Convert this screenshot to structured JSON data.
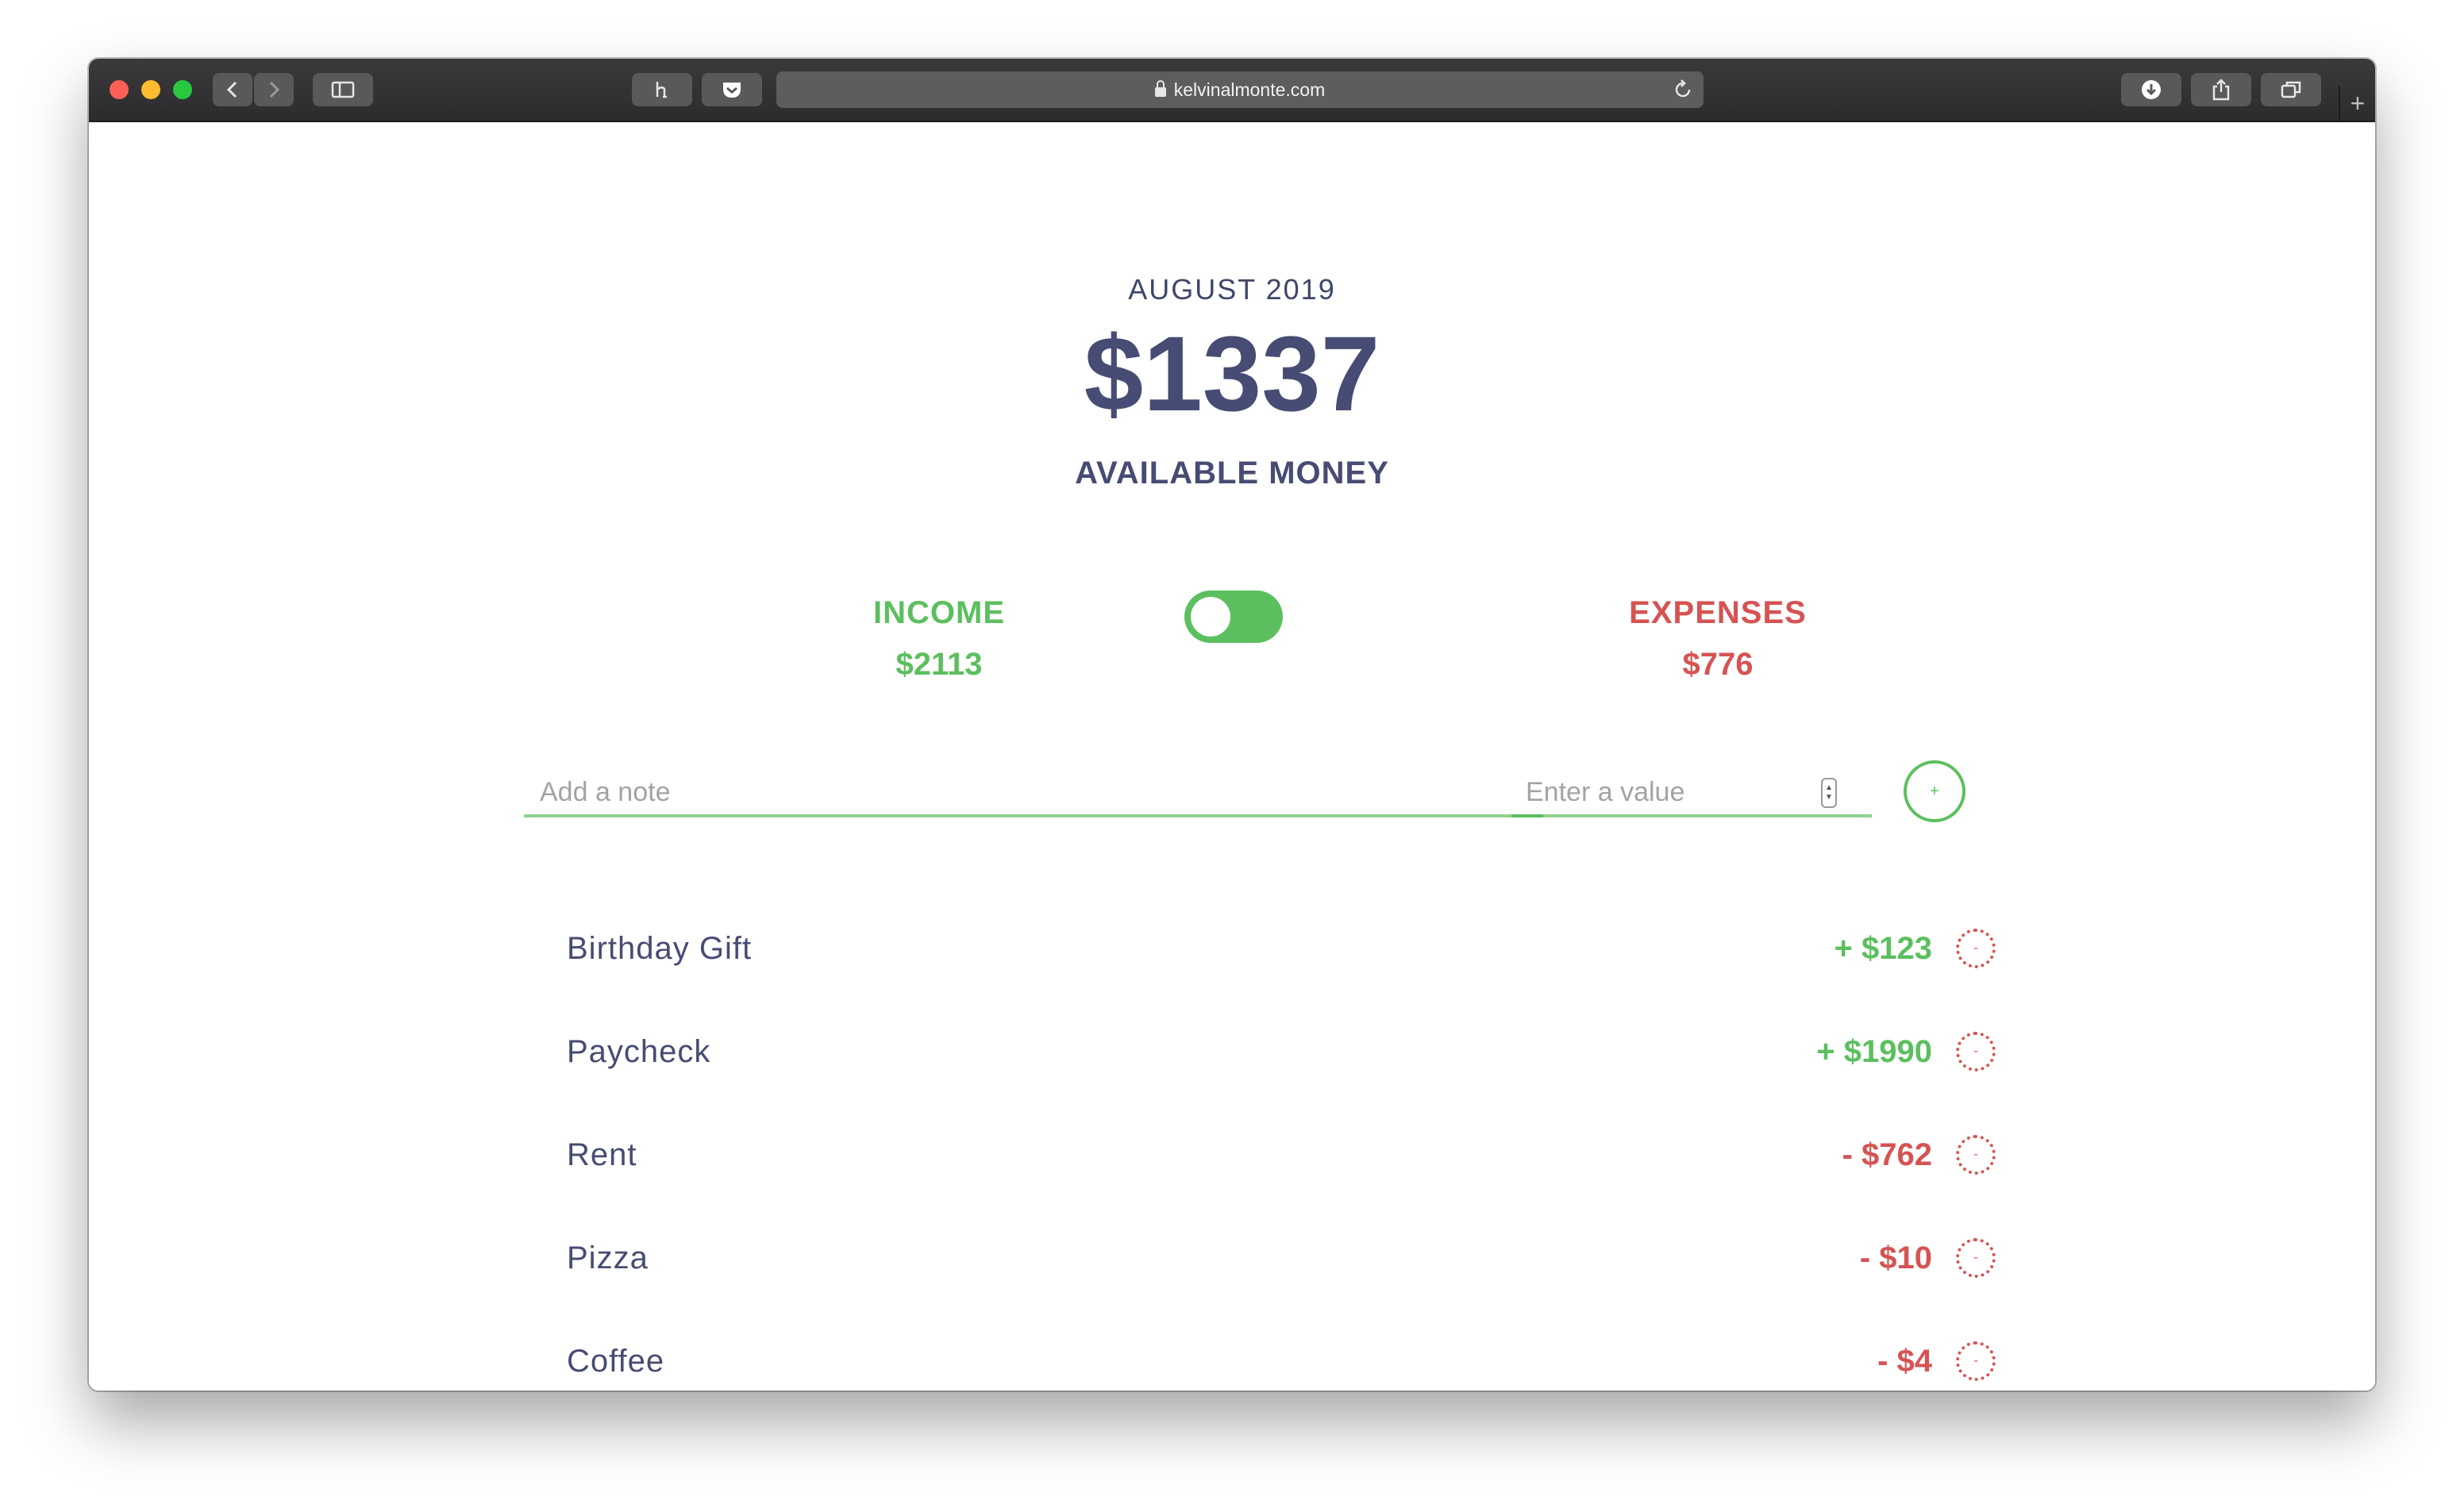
{
  "browser": {
    "url": "kelvinalmonte.com",
    "new_tab": "+"
  },
  "summary": {
    "month": "AUGUST 2019",
    "balance": "$1337",
    "balance_label": "AVAILABLE MONEY"
  },
  "income": {
    "label": "INCOME",
    "value": "$2113",
    "color": "#5cbf5f"
  },
  "expenses": {
    "label": "EXPENSES",
    "value": "$776",
    "color": "#d65353"
  },
  "toggle": {
    "state": "income"
  },
  "form": {
    "note_placeholder": "Add a note",
    "value_placeholder": "Enter a value",
    "add_label": "+"
  },
  "transactions": [
    {
      "note": "Birthday Gift",
      "amount": "+ $123",
      "type": "income",
      "delete_label": "-"
    },
    {
      "note": "Paycheck",
      "amount": "+ $1990",
      "type": "income",
      "delete_label": "-"
    },
    {
      "note": "Rent",
      "amount": "- $762",
      "type": "expense",
      "delete_label": "-"
    },
    {
      "note": "Pizza",
      "amount": "- $10",
      "type": "expense",
      "delete_label": "-"
    },
    {
      "note": "Coffee",
      "amount": "- $4",
      "type": "expense",
      "delete_label": "-"
    }
  ]
}
